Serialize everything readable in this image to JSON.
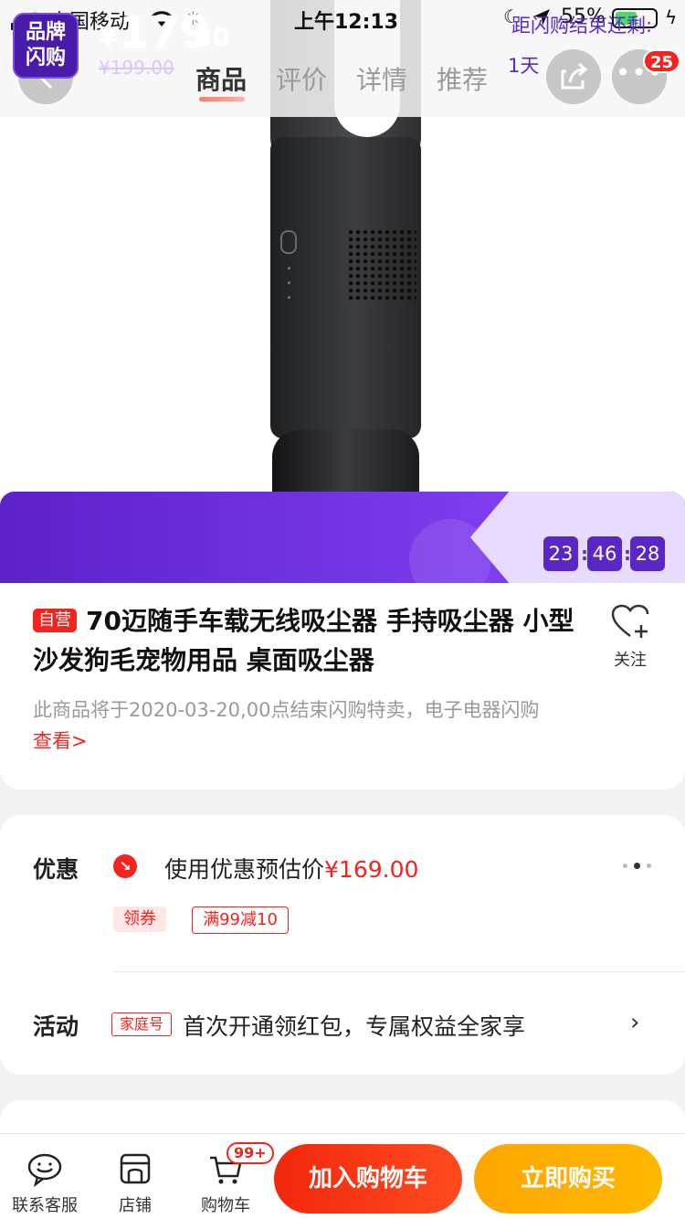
{
  "status_bar": {
    "carrier": "中国移动",
    "time": "上午12:13",
    "battery_percent": "55%",
    "battery_level": 0.55
  },
  "nav": {
    "tabs": [
      {
        "label": "商品",
        "active": true
      },
      {
        "label": "评价",
        "active": false
      },
      {
        "label": "详情",
        "active": false
      },
      {
        "label": "推荐",
        "active": false
      }
    ],
    "message_badge": "25"
  },
  "flash_sale": {
    "tag_line1": "品牌",
    "tag_line2": "闪购",
    "currency": "¥",
    "price_integer": "179",
    "price_decimal": ".00",
    "original_price": "¥199.00",
    "countdown_label": "距闪购结束还剩:",
    "days": "1天",
    "hours": "23",
    "minutes": "46",
    "seconds": "28",
    "separator": ":"
  },
  "product": {
    "self_tag": "自营",
    "title": "70迈随手车载无线吸尘器 手持吸尘器 小型沙发狗毛宠物用品 桌面吸尘器",
    "follow_label": "关注",
    "notice": "此商品将于2020-03-20,00点结束闪购特卖，电子电器闪购",
    "notice_link": "查看>"
  },
  "promo": {
    "label": "优惠",
    "text": "使用优惠预估价",
    "price": "¥169.00",
    "coupon_tag": "领券",
    "coupon_offer": "满99减10"
  },
  "activity": {
    "label": "活动",
    "tag": "家庭号",
    "text": "首次开通领红包，专属权益全家享",
    "chevron": "›"
  },
  "bottom_bar": {
    "service_label": "联系客服",
    "store_label": "店铺",
    "cart_label": "购物车",
    "cart_badge": "99+",
    "add_to_cart": "加入购物车",
    "buy_now": "立即购买"
  },
  "colors": {
    "accent_red": "#f3241f",
    "flash_purple": "#6a2fd3",
    "buy_orange": "#ffa600"
  }
}
